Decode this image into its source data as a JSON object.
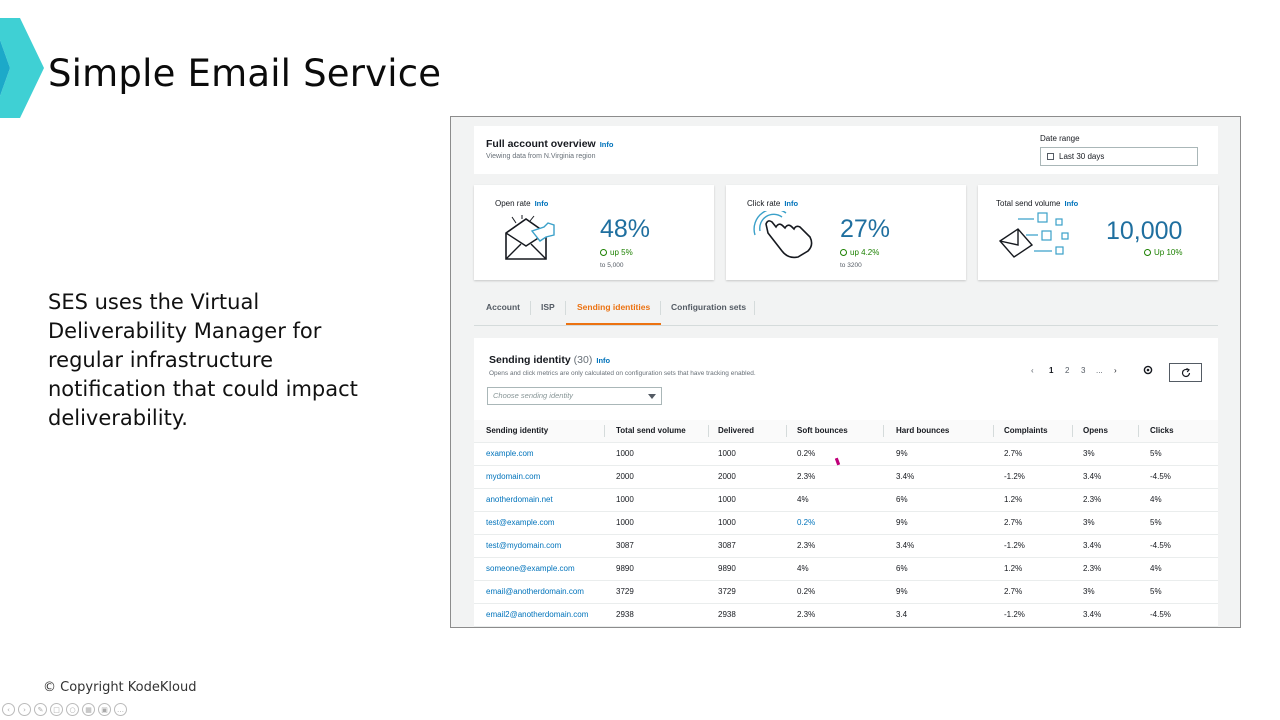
{
  "slide": {
    "title": "Simple Email Service",
    "body": "SES uses the Virtual Deliverability Manager for regular infrastructure notification that could impact deliverability.",
    "copyright": "© Copyright KodeKloud",
    "accent_colors": [
      "#3fd0d4",
      "#1ca9c9"
    ]
  },
  "console": {
    "overview": {
      "title": "Full account overview",
      "info": "Info",
      "subtitle": "Viewing data from N.Virginia region",
      "date_range_label": "Date range",
      "date_range_value": "Last 30 days"
    },
    "metrics": [
      {
        "label": "Open rate",
        "info": "Info",
        "value": "48%",
        "change": "up 5%",
        "sub": "to 5,000",
        "icon": "envelope-open-icon"
      },
      {
        "label": "Click rate",
        "info": "Info",
        "value": "27%",
        "change": "up 4.2%",
        "sub": "to 3200",
        "icon": "hand-click-icon"
      },
      {
        "label": "Total send volume",
        "info": "Info",
        "value": "10,000",
        "change": "Up 10%",
        "sub": "",
        "icon": "envelope-send-icon"
      }
    ],
    "tabs": [
      "Account",
      "ISP",
      "Sending identities",
      "Configuration sets"
    ],
    "active_tab": "Sending identities",
    "panel": {
      "title": "Sending identity",
      "count": "(30)",
      "info": "Info",
      "note": "Opens and click metrics are only calculated on configuration sets that have tracking enabled.",
      "select_placeholder": "Choose sending identity",
      "pages": [
        "1",
        "2",
        "3",
        "..."
      ],
      "current_page": "1"
    },
    "table": {
      "columns": [
        "Sending identity",
        "Total send volume",
        "Delivered",
        "Soft bounces",
        "Hard bounces",
        "Complaints",
        "Opens",
        "Clicks"
      ],
      "rows": [
        [
          "example.com",
          "1000",
          "1000",
          "0.2%",
          "9%",
          "2.7%",
          "3%",
          "5%"
        ],
        [
          "mydomain.com",
          "2000",
          "2000",
          "2.3%",
          "3.4%",
          "-1.2%",
          "3.4%",
          "-4.5%"
        ],
        [
          "anotherdomain.net",
          "1000",
          "1000",
          "4%",
          "6%",
          "1.2%",
          "2.3%",
          "4%"
        ],
        [
          "test@example.com",
          "1000",
          "1000",
          "0.2%",
          "9%",
          "2.7%",
          "3%",
          "5%"
        ],
        [
          "test@mydomain.com",
          "3087",
          "3087",
          "2.3%",
          "3.4%",
          "-1.2%",
          "3.4%",
          "-4.5%"
        ],
        [
          "someone@example.com",
          "9890",
          "9890",
          "4%",
          "6%",
          "1.2%",
          "2.3%",
          "4%"
        ],
        [
          "email@anotherdomain.com",
          "3729",
          "3729",
          "0.2%",
          "9%",
          "2.7%",
          "3%",
          "5%"
        ],
        [
          "email2@anotherdomain.com",
          "2938",
          "2938",
          "2.3%",
          "3.4",
          "-1.2%",
          "3.4%",
          "-4.5%"
        ]
      ]
    },
    "colors": {
      "link": "#0073bb",
      "accent": "#ec7211",
      "value": "#1f6f9f",
      "positive": "#1d8102"
    }
  }
}
